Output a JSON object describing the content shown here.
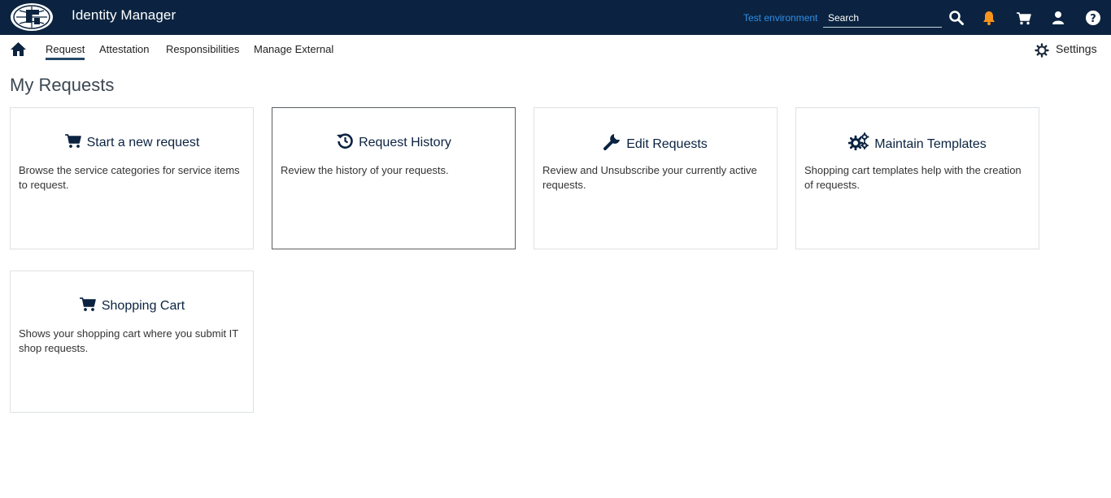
{
  "header": {
    "app_title": "Identity Manager",
    "environment": "Test environment",
    "search_placeholder": "Search",
    "icons": [
      "search-icon",
      "bell-icon",
      "cart-icon",
      "user-icon",
      "help-icon"
    ],
    "notification_color": "#f7941d",
    "bar_color": "#0b2340"
  },
  "nav": {
    "items": [
      {
        "label": "Request",
        "active": true
      },
      {
        "label": "Attestation"
      },
      {
        "label": "Responsibilities"
      },
      {
        "label": "Manage External"
      }
    ],
    "settings_label": "Settings"
  },
  "main": {
    "title": "My Requests",
    "tiles": [
      {
        "icon": "cart-icon",
        "title": "Start a new request",
        "description": "Browse the service categories for service items to request."
      },
      {
        "icon": "history-icon",
        "title": "Request History",
        "description": "Review the history of your requests."
      },
      {
        "icon": "wrench-icon",
        "title": "Edit Requests",
        "description": "Review and Unsubscribe your currently active requests."
      },
      {
        "icon": "gears-icon",
        "title": "Maintain Templates",
        "description": "Shopping cart templates help with the creation of requests."
      },
      {
        "icon": "cart-icon",
        "title": "Shopping Cart",
        "description": "Shows your shopping cart where you submit IT shop requests."
      }
    ]
  }
}
